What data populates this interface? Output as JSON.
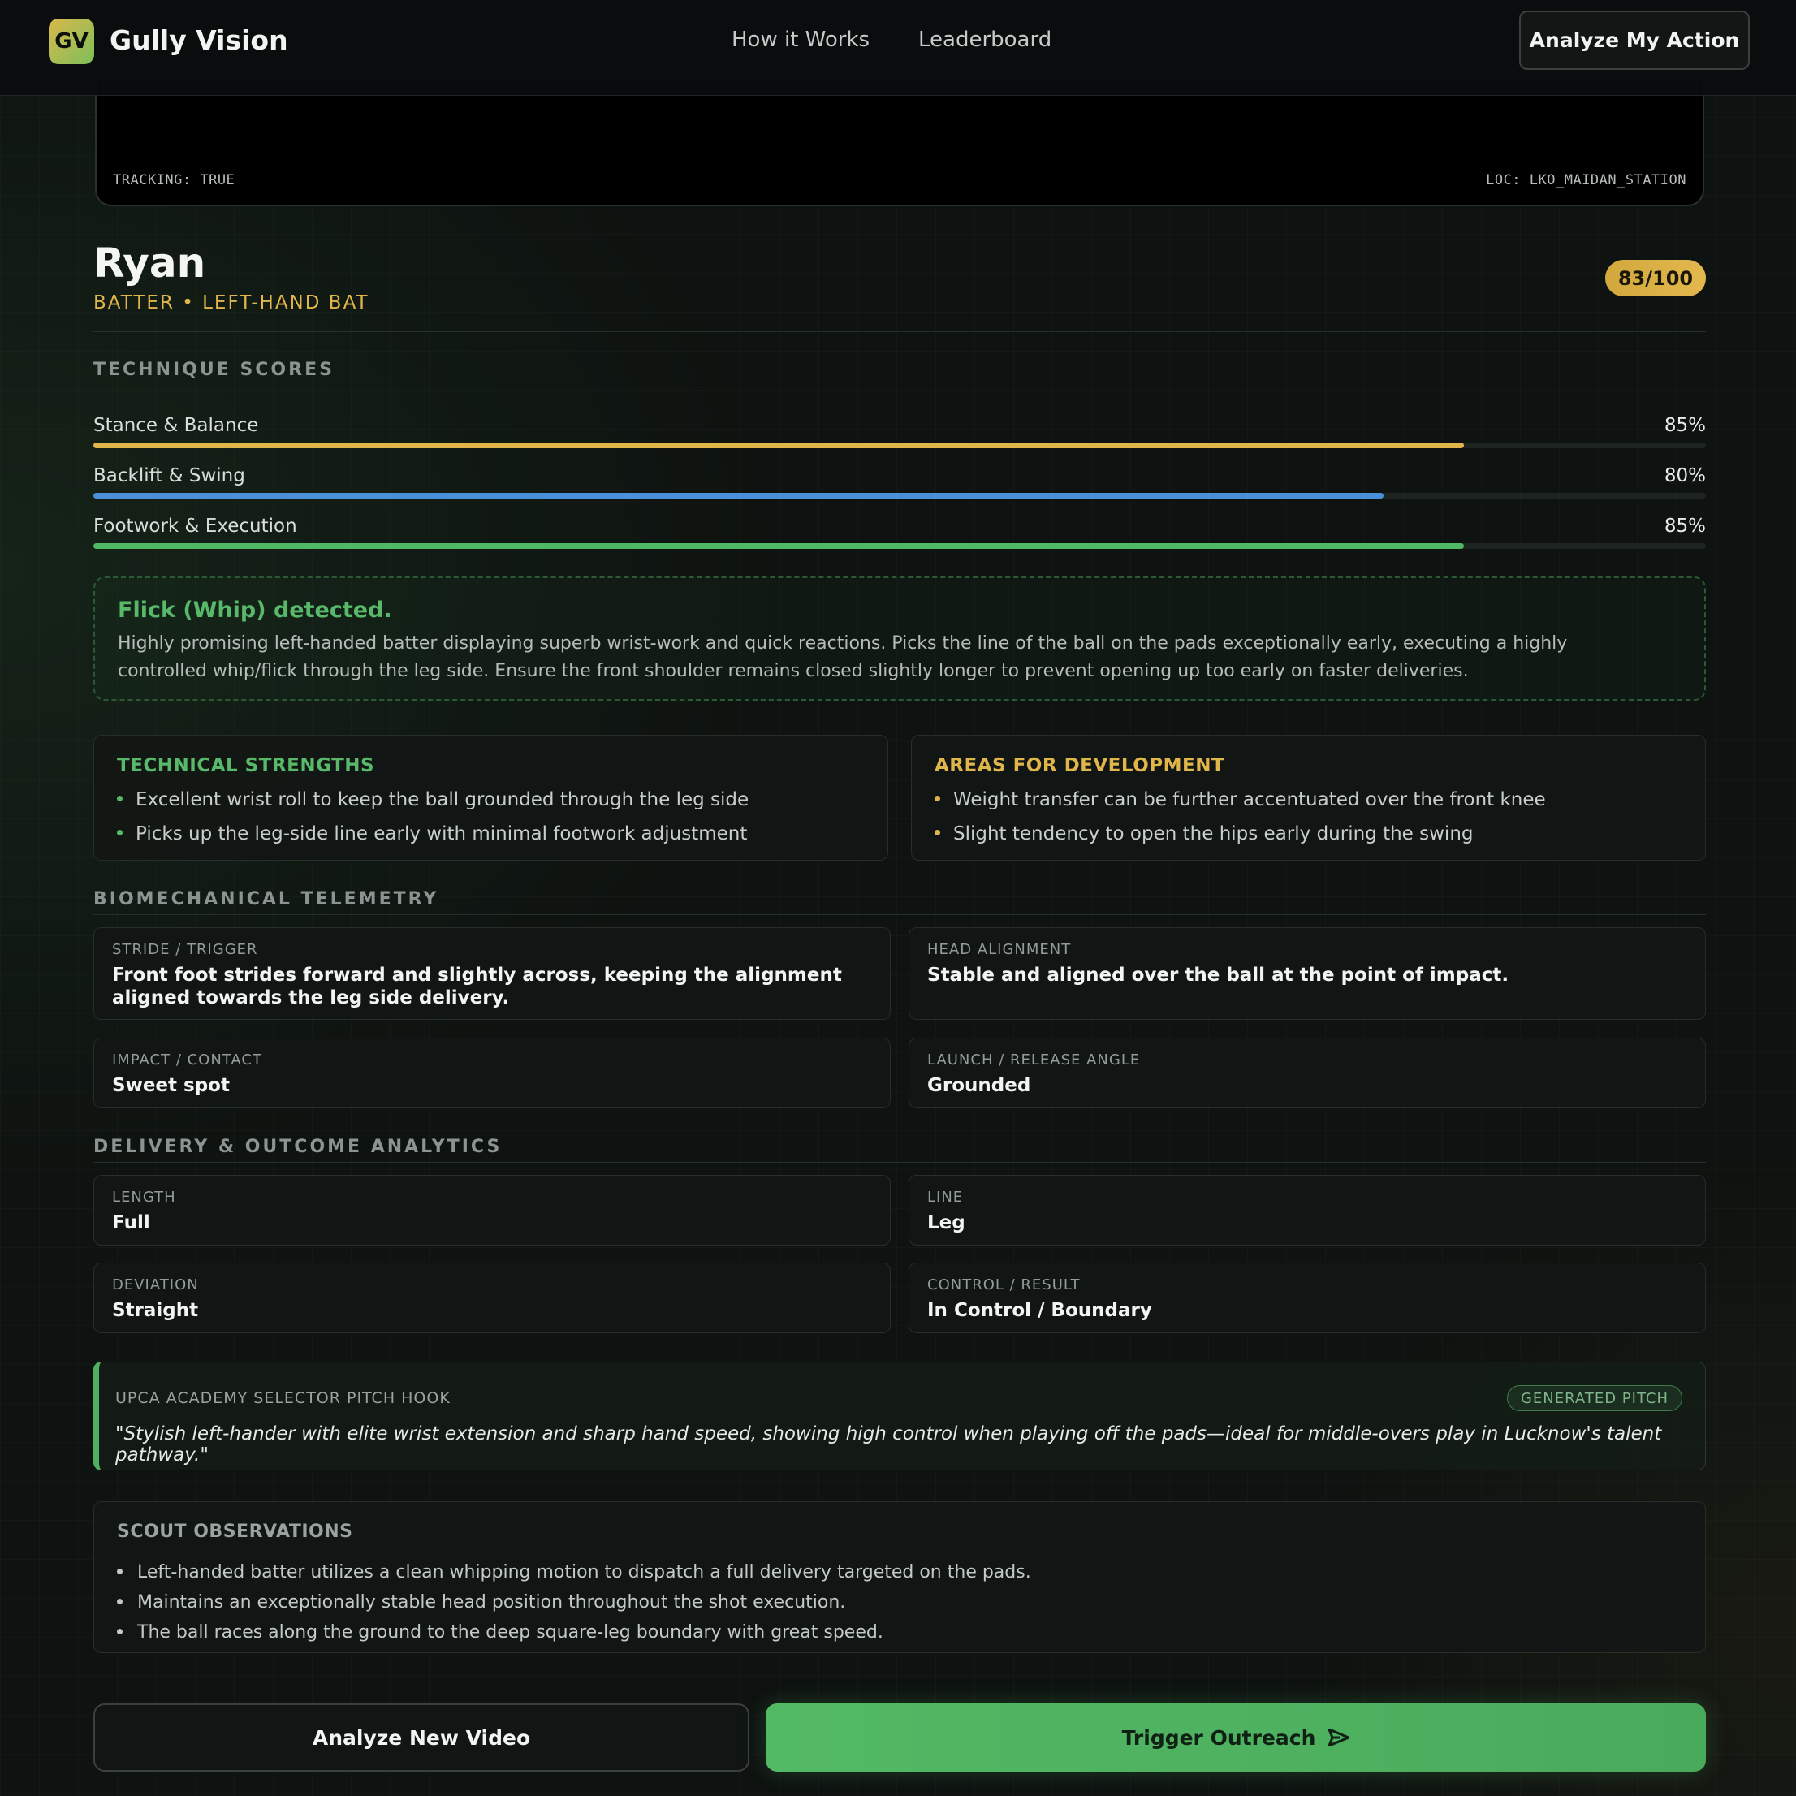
{
  "header": {
    "logo_text": "GV",
    "brand": "Gully Vision",
    "nav": [
      "How it Works",
      "Leaderboard"
    ],
    "cta": "Analyze My Action"
  },
  "video": {
    "tracking": "TRACKING: TRUE",
    "location": "LOC: LKO_MAIDAN_STATION"
  },
  "player": {
    "name": "Ryan",
    "role": "BATTER • LEFT-HAND BAT",
    "score": "83/100"
  },
  "technique": {
    "title": "TECHNIQUE SCORES",
    "bars": [
      {
        "label": "Stance & Balance",
        "pct_label": "85%",
        "value": 0.85,
        "color": "#e0b54a"
      },
      {
        "label": "Backlift & Swing",
        "pct_label": "80%",
        "value": 0.8,
        "color": "#4a90d9"
      },
      {
        "label": "Footwork & Execution",
        "pct_label": "85%",
        "value": 0.85,
        "color": "#4fb864"
      }
    ]
  },
  "insight": {
    "title": "Flick (Whip) detected.",
    "body": "Highly promising left-handed batter displaying superb wrist-work and quick reactions. Picks the line of the ball on the pads exceptionally early, executing a highly controlled whip/flick through the leg side. Ensure the front shoulder remains closed slightly longer to prevent opening up too early on faster deliveries."
  },
  "strengths": {
    "title": "TECHNICAL STRENGTHS",
    "color": "#58b96a",
    "items": [
      "Excellent wrist roll to keep the ball grounded through the leg side",
      "Picks up the leg-side line early with minimal footwork adjustment"
    ]
  },
  "development": {
    "title": "AREAS FOR DEVELOPMENT",
    "color": "#e0b54a",
    "items": [
      "Weight transfer can be further accentuated over the front knee",
      "Slight tendency to open the hips early during the swing"
    ]
  },
  "telemetry": {
    "title": "BIOMECHANICAL TELEMETRY",
    "cells": [
      {
        "label": "STRIDE / TRIGGER",
        "value": "Front foot strides forward and slightly across, keeping the alignment aligned towards the leg side delivery."
      },
      {
        "label": "HEAD ALIGNMENT",
        "value": "Stable and aligned over the ball at the point of impact."
      },
      {
        "label": "IMPACT / CONTACT",
        "value": "Sweet spot"
      },
      {
        "label": "LAUNCH / RELEASE ANGLE",
        "value": "Grounded"
      }
    ]
  },
  "delivery": {
    "title": "DELIVERY & OUTCOME ANALYTICS",
    "cells": [
      {
        "label": "LENGTH",
        "value": "Full"
      },
      {
        "label": "LINE",
        "value": "Leg"
      },
      {
        "label": "DEVIATION",
        "value": "Straight"
      },
      {
        "label": "CONTROL / RESULT",
        "value": "In Control / Boundary"
      }
    ]
  },
  "pitch": {
    "label": "UPCA ACADEMY SELECTOR PITCH HOOK",
    "badge": "GENERATED PITCH",
    "quote": "\"Stylish left-hander with elite wrist extension and sharp hand speed, showing high control when playing off the pads—ideal for middle-overs play in Lucknow's talent pathway.\""
  },
  "scout": {
    "title": "SCOUT OBSERVATIONS",
    "items": [
      "Left-handed batter utilizes a clean whipping motion to dispatch a full delivery targeted on the pads.",
      "Maintains an exceptionally stable head position throughout the shot execution.",
      "The ball races along the ground to the deep square-leg boundary with great speed."
    ]
  },
  "actions": {
    "secondary": "Analyze New Video",
    "primary": "Trigger Outreach"
  }
}
